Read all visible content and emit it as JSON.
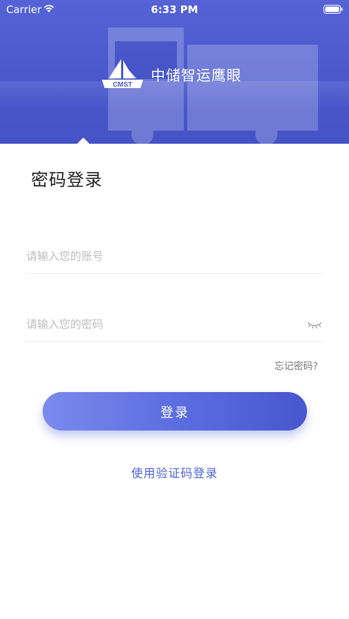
{
  "status_bar": {
    "carrier": "Carrier",
    "time": "6:33 PM"
  },
  "header": {
    "brand_name": "中储智运鹰眼",
    "logo_text": "CMST",
    "gradient_colors": [
      "#5563d6",
      "#4553c6"
    ]
  },
  "page_title": "密码登录",
  "form": {
    "account_placeholder": "请输入您的账号",
    "password_placeholder": "请输入您的密码",
    "forgot_password": "忘记密码?",
    "login_label": "登录",
    "sms_login_link": "使用验证码登录"
  },
  "icons": {
    "wifi": "wifi-icon",
    "battery": "battery-icon",
    "logo": "sailboat-logo",
    "password_visibility": "eye-closed-icon"
  },
  "colors": {
    "accent": "#5b6ee0",
    "link": "#4a64d8",
    "placeholder": "#bdbdbd"
  }
}
